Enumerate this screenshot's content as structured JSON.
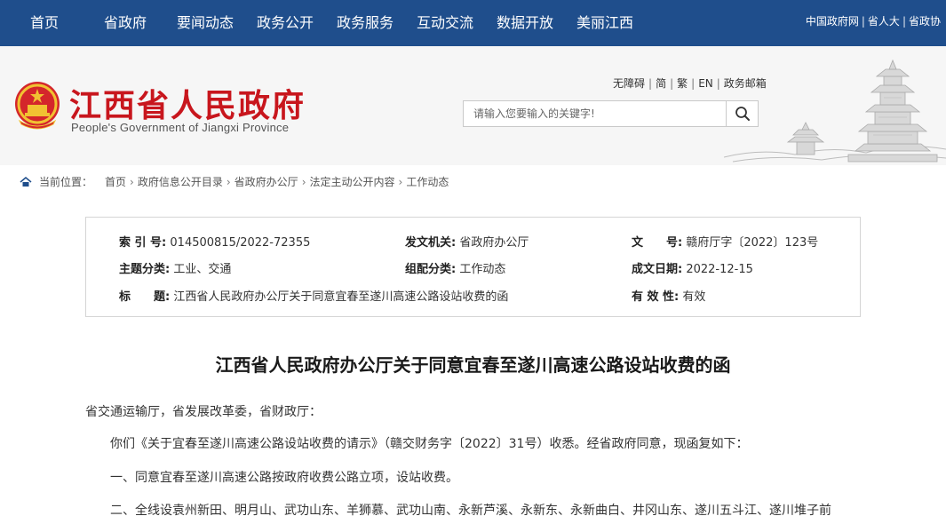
{
  "topnav": {
    "items": [
      "首页",
      "省政府",
      "要闻动态",
      "政务公开",
      "政务服务",
      "互动交流",
      "数据开放",
      "美丽江西"
    ],
    "right_links": [
      "中国政府网",
      "省人大",
      "省政协"
    ],
    "separator": "|"
  },
  "header": {
    "site_title": "江西省人民政府",
    "site_subtitle": "People's Government of Jiangxi Province",
    "util_links": [
      "无障碍",
      "简",
      "繁",
      "EN",
      "政务邮箱"
    ],
    "util_separator": "|",
    "search_placeholder": "请输入您要输入的关键字!"
  },
  "breadcrumb": {
    "label": "当前位置：",
    "items": [
      "首页",
      "政府信息公开目录",
      "省政府办公厅",
      "法定主动公开内容",
      "工作动态"
    ],
    "arrow": "›"
  },
  "info": {
    "index_label": "索 引 号:",
    "index_value": "014500815/2022-72355",
    "issuer_label": "发文机关:",
    "issuer_value": "省政府办公厅",
    "docno_label": "文　　号:",
    "docno_value": "赣府厅字〔2022〕123号",
    "topic_label": "主题分类:",
    "topic_value": "工业、交通",
    "group_label": "组配分类:",
    "group_value": "工作动态",
    "date_label": "成文日期:",
    "date_value": "2022-12-15",
    "title_label": "标　　题:",
    "title_value": "江西省人民政府办公厅关于同意宜春至遂川高速公路设站收费的函",
    "validity_label": "有 效 性:",
    "validity_value": "有效"
  },
  "article": {
    "title": "江西省人民政府办公厅关于同意宜春至遂川高速公路设站收费的函",
    "recipients": "省交通运输厅，省发展改革委，省财政厅：",
    "paragraphs": [
      "你们《关于宜春至遂川高速公路设站收费的请示》（赣交财务字〔2022〕31号）收悉。经省政府同意，现函复如下：",
      "一、同意宜春至遂川高速公路按政府收费公路立项，设站收费。",
      "二、全线设袁州新田、明月山、武功山东、羊狮慕、武功山南、永新芦溪、永新东、永新曲白、井冈山东、遂川五斗江、遂川堆子前"
    ]
  },
  "colors": {
    "nav_bg": "#1f4e8c",
    "title_red": "#c8161d",
    "header_bg": "#f6f6f6"
  }
}
